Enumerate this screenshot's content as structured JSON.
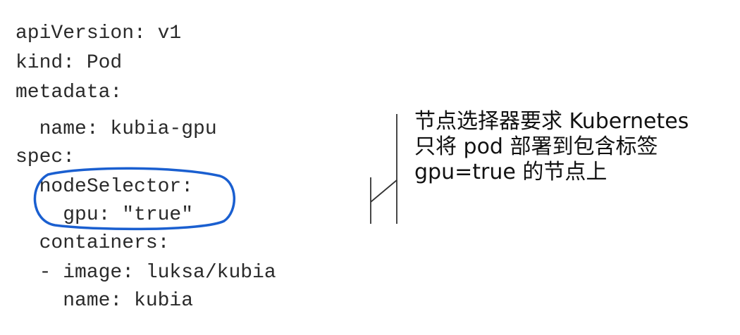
{
  "code_lines": [
    {
      "text": "apiVersion: v1"
    },
    {
      "text": "kind: Pod"
    },
    {
      "text": "metadata:"
    },
    {
      "text": "  name: kubia-gpu"
    },
    {
      "text": "spec:"
    },
    {
      "text": "  nodeSelector:"
    },
    {
      "text": "    gpu: \"true\""
    },
    {
      "text": "  containers:"
    },
    {
      "text": "  - image: luksa/kubia"
    },
    {
      "text": "    name: kubia"
    }
  ],
  "annotation": {
    "lines": [
      "节点选择器要求 Kubernetes",
      "只将 pod 部署到包含标签",
      "gpu=true 的节点上"
    ]
  },
  "colors": {
    "highlight": "#1a5fd0",
    "code_text": "#2a2a2a",
    "bracket": "#333333"
  }
}
